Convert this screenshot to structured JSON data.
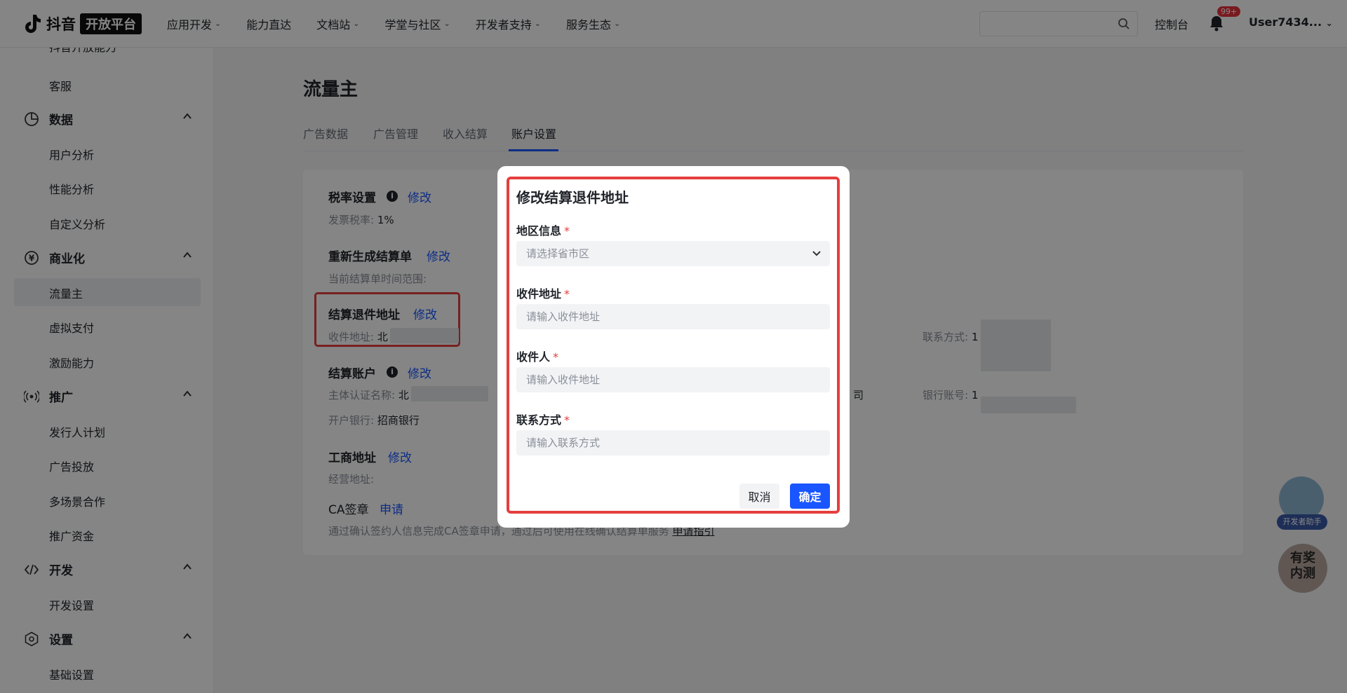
{
  "header": {
    "brand": "抖音",
    "badge": "开放平台",
    "nav": [
      {
        "label": "应用开发",
        "dropdown": true
      },
      {
        "label": "能力直达",
        "dropdown": false
      },
      {
        "label": "文档站",
        "dropdown": true
      },
      {
        "label": "学堂与社区",
        "dropdown": true
      },
      {
        "label": "开发者支持",
        "dropdown": true
      },
      {
        "label": "服务生态",
        "dropdown": true
      }
    ],
    "console": "控制台",
    "notif_count": "99+",
    "user": "User7434..."
  },
  "sidebar": {
    "cutoff_top": "抖音开放能力",
    "cutoff_bottom": "基础设置",
    "items": {
      "kefu": "客服",
      "data": "数据",
      "user_analysis": "用户分析",
      "perf_analysis": "性能分析",
      "custom_analysis": "自定义分析",
      "commerce": "商业化",
      "traffic_owner": "流量主",
      "virtual_pay": "虚拟支付",
      "incentive": "激励能力",
      "promote": "推广",
      "publisher_plan": "发行人计划",
      "ad_delivery": "广告投放",
      "multi_scene": "多场景合作",
      "promo_funds": "推广资金",
      "develop": "开发",
      "dev_settings": "开发设置",
      "settings": "设置"
    }
  },
  "main": {
    "title": "流量主",
    "tabs": [
      "广告数据",
      "广告管理",
      "收入结算",
      "账户设置"
    ],
    "active_tab": "账户设置",
    "tax": {
      "label": "税率设置",
      "action": "修改",
      "sub_label": "发票税率: ",
      "sub_value": "1%"
    },
    "regen": {
      "label": "重新生成结算单",
      "action": "修改",
      "sub_label": "当前结算单时间范围:"
    },
    "return_addr": {
      "label": "结算退件地址",
      "action": "修改",
      "sub_label": "收件地址: ",
      "sub_value": "北",
      "contact_label": "联系方式: ",
      "contact_value": "1"
    },
    "account": {
      "label": "结算账户",
      "action": "修改",
      "entity_label": "主体认证名称: ",
      "entity_value": "北",
      "entity_tail": "司",
      "bank_no_label": "银行账号: ",
      "bank_no_value": "1",
      "bank_label": "开户银行: ",
      "bank_value": "招商银行"
    },
    "biz_addr": {
      "label": "工商地址",
      "action": "修改",
      "sub_label": "经营地址:"
    },
    "ca": {
      "label": "CA签章",
      "action": "申请",
      "desc": "通过确认签约人信息完成CA签章申请，通过后可使用在线确认结算单服务",
      "guide": "申请指引"
    }
  },
  "modal": {
    "title": "修改结算退件地址",
    "fields": {
      "region": {
        "label": "地区信息",
        "placeholder": "请选择省市区"
      },
      "address": {
        "label": "收件地址",
        "placeholder": "请输入收件地址"
      },
      "recipient": {
        "label": "收件人",
        "placeholder": "请输入收件地址"
      },
      "contact": {
        "label": "联系方式",
        "placeholder": "请输入联系方式"
      }
    },
    "required_mark": "*",
    "cancel": "取消",
    "confirm": "确定"
  },
  "floating": {
    "assistant": "开发者助手",
    "reward_line1": "有奖",
    "reward_line2": "内测"
  },
  "colors": {
    "accent": "#1a56ff",
    "highlight": "#e53e3e",
    "required": "#e53e3e"
  }
}
